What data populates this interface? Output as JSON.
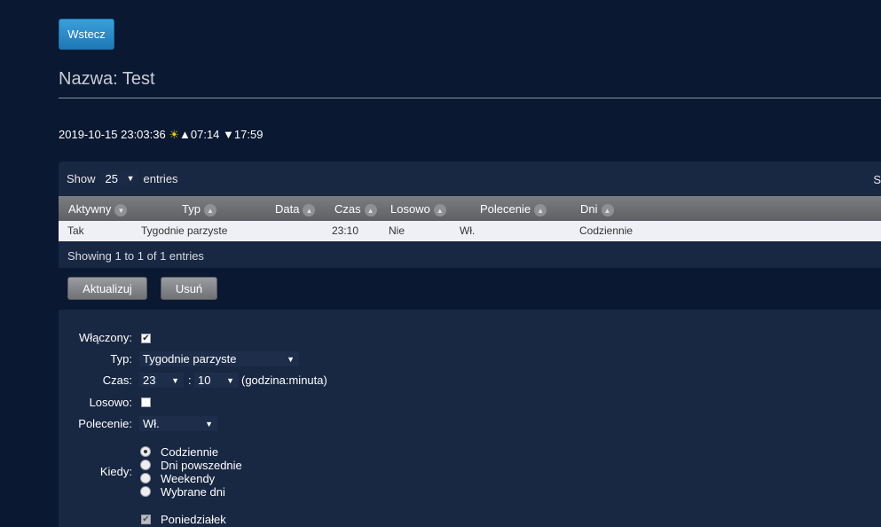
{
  "header": {
    "back_label": "Wstecz",
    "title": "Nazwa: Test",
    "datetime": "2019-10-15 23:03:36",
    "sun_icon": "☀",
    "sunrise": "▲07:14",
    "sunset": "▼17:59"
  },
  "table": {
    "show_label": "Show",
    "page_length": "25",
    "entries_label": "entries",
    "search_label": "S",
    "columns": [
      "Aktywny",
      "Typ",
      "Data",
      "Czas",
      "Losowo",
      "Polecenie",
      "Dni"
    ],
    "rows": [
      [
        "Tak",
        "Tygodnie parzyste",
        "",
        "23:10",
        "Nie",
        "Wł.",
        "Codziennie"
      ]
    ],
    "info": "Showing 1 to 1 of 1 entries"
  },
  "actions": {
    "update_label": "Aktualizuj",
    "delete_label": "Usuń"
  },
  "form": {
    "enabled_label": "Włączony:",
    "enabled_checked": true,
    "type_label": "Typ:",
    "type_value": "Tygodnie parzyste",
    "time_label": "Czas:",
    "hour_value": "23",
    "time_separator": ":",
    "minute_value": "10",
    "time_hint": "(godzina:minuta)",
    "random_label": "Losowo:",
    "random_checked": false,
    "command_label": "Polecenie:",
    "command_value": "Wł.",
    "when_label": "Kiedy:",
    "when_options": [
      "Codziennie",
      "Dni powszednie",
      "Weekendy",
      "Wybrane dni"
    ],
    "when_selected": 0,
    "days": [
      "Poniedziałek"
    ]
  },
  "colors": {
    "background": "#0a1832",
    "panel": "#182742",
    "accent_button": "#2a8cc8",
    "header_row": "#6b6d71"
  }
}
